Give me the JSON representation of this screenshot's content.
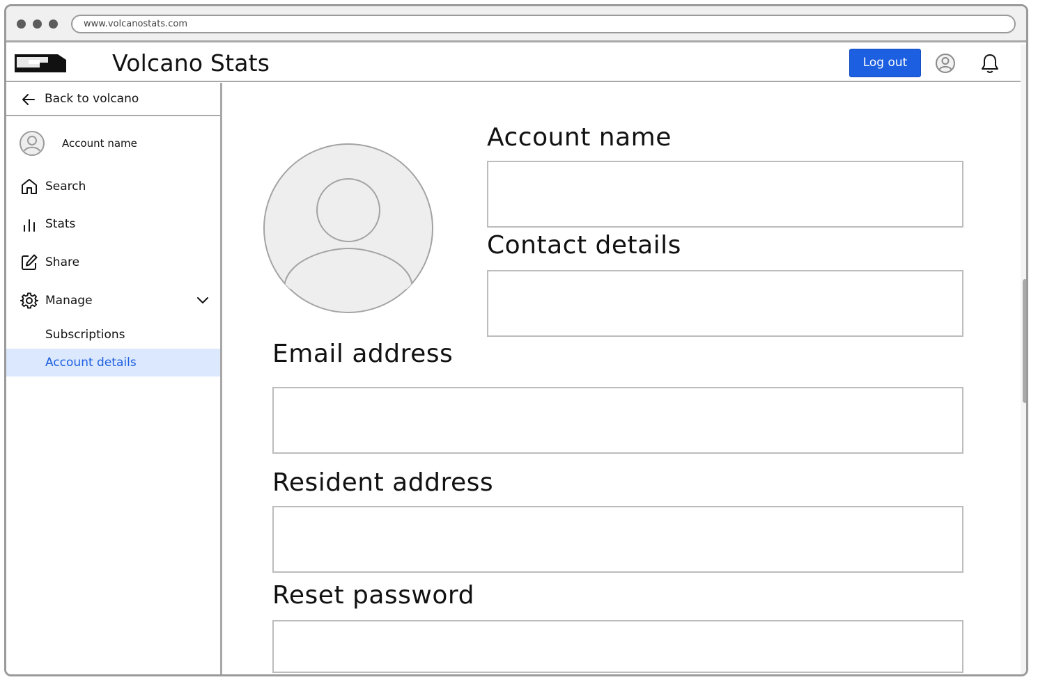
{
  "browser": {
    "url": "www.volcanostats.com"
  },
  "header": {
    "title": "Volcano Stats",
    "logout_label": "Log out",
    "icons": [
      "user-circle-icon",
      "bell-icon"
    ]
  },
  "sidebar": {
    "back_label": "Back to volcano",
    "account_label": "Account name",
    "items": [
      {
        "label": "Search",
        "icon": "home-icon"
      },
      {
        "label": "Stats",
        "icon": "bar-chart-icon"
      },
      {
        "label": "Share",
        "icon": "edit-icon"
      },
      {
        "label": "Manage",
        "icon": "gear-icon",
        "expanded": true
      }
    ],
    "sub_items": [
      {
        "label": "Subscriptions",
        "active": false
      },
      {
        "label": "Account details",
        "active": true
      }
    ]
  },
  "form": {
    "account_name_label": "Account name",
    "contact_details_label": "Contact details",
    "email_label": "Email address",
    "resident_label": "Resident address",
    "password_label": "Reset password",
    "account_name_value": "",
    "contact_details_value": "",
    "email_value": "",
    "resident_value": "",
    "password_value": ""
  },
  "colors": {
    "accent": "#1c5fe0",
    "active_bg": "#dce8fd",
    "border": "#a8a8a8"
  }
}
